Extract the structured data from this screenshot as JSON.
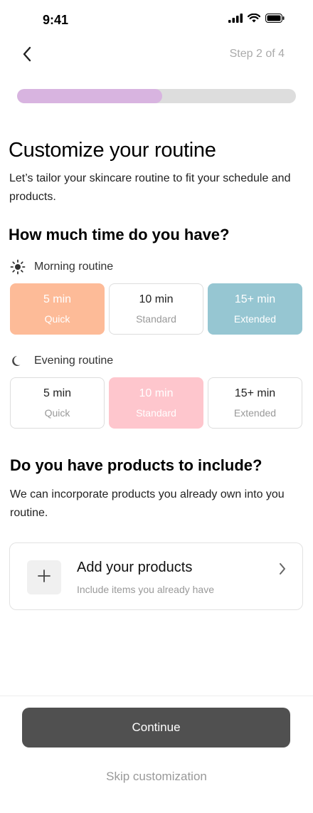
{
  "status_bar": {
    "time": "9:41",
    "icons": [
      "cellular-signal-icon",
      "wifi-icon",
      "battery-icon"
    ]
  },
  "nav": {
    "back_icon": "chevron-left-icon",
    "step_label": "Step 2 of 4"
  },
  "progress": {
    "fraction": 0.52,
    "color": "#d8b4e0"
  },
  "header": {
    "title": "Customize your routine",
    "intro": "Let’s tailor your skincare routine to fit your schedule and products."
  },
  "time_section": {
    "title": "How much time do you have?",
    "morning": {
      "icon": "sun-icon",
      "label": "Morning routine",
      "options": [
        {
          "time": "5 min",
          "sub": "Quick",
          "state": "selected-peach"
        },
        {
          "time": "10 min",
          "sub": "Standard",
          "state": "default"
        },
        {
          "time": "15+ min",
          "sub": "Extended",
          "state": "selected-teal"
        }
      ]
    },
    "evening": {
      "icon": "moon-icon",
      "label": "Evening routine",
      "options": [
        {
          "time": "5 min",
          "sub": "Quick",
          "state": "default"
        },
        {
          "time": "10 min",
          "sub": "Standard",
          "state": "selected-pink"
        },
        {
          "time": "15+ min",
          "sub": "Extended",
          "state": "default"
        }
      ]
    }
  },
  "products_section": {
    "title": "Do you have products to include?",
    "text": "We can incorporate products you already own into you routine.",
    "add_card": {
      "icon": "plus-icon",
      "title": "Add your products",
      "subtitle": "Include items you already have",
      "chevron_icon": "chevron-right-icon"
    }
  },
  "footer": {
    "continue_label": "Continue",
    "skip_label": "Skip customization"
  },
  "colors": {
    "peach": "#fdbb98",
    "teal": "#96c6d2",
    "pink": "#fec6cd",
    "button": "#505050"
  }
}
